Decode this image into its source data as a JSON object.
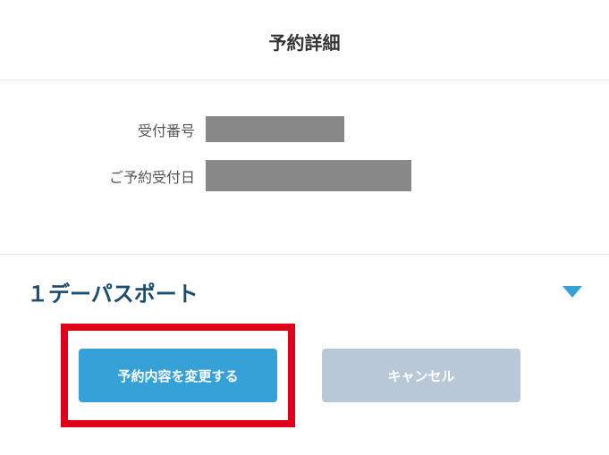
{
  "header": {
    "title": "予約詳細"
  },
  "details": {
    "reception_number_label": "受付番号",
    "reception_date_label": "ご予約受付日"
  },
  "ticket": {
    "section_title": "１デーパスポート",
    "change_button": "予約内容を変更する",
    "cancel_button": "キャンセル"
  }
}
